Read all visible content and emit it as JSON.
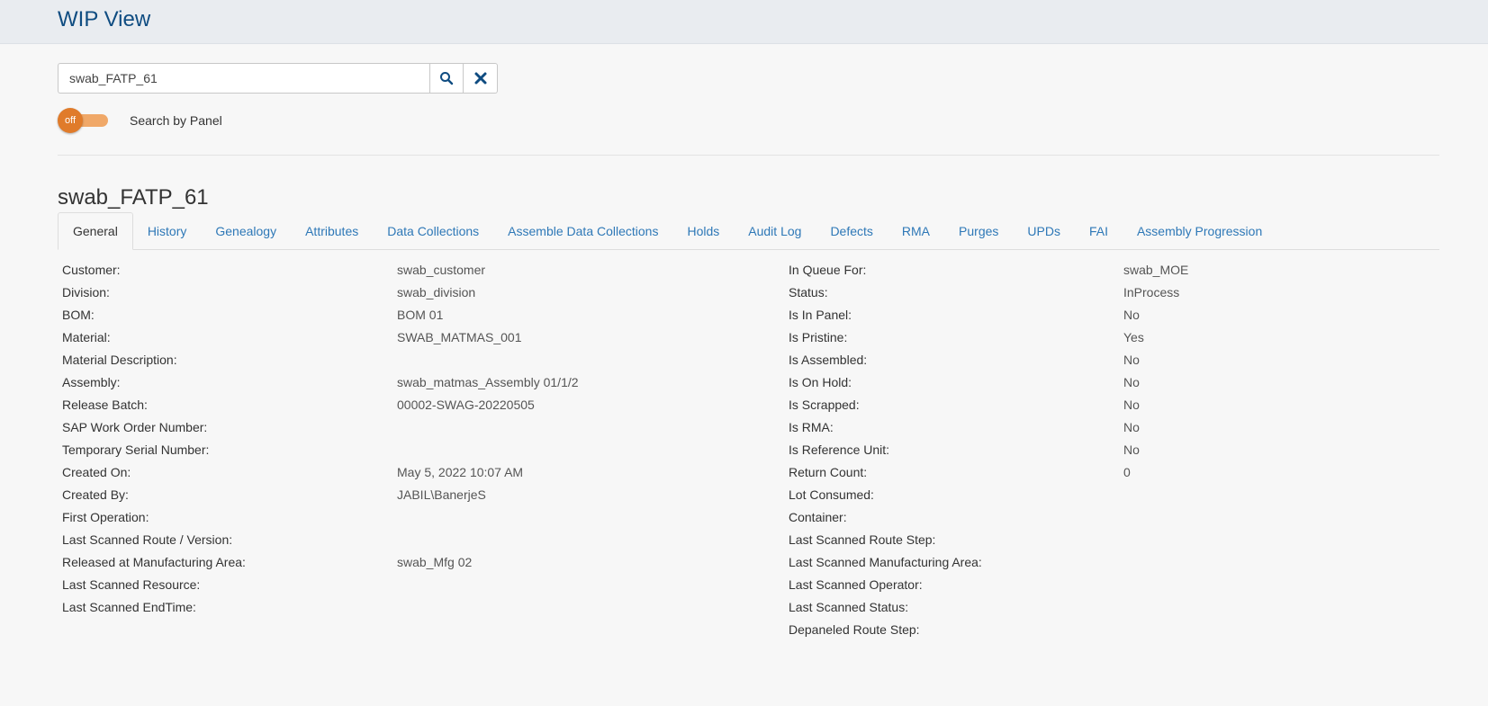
{
  "header": {
    "title": "WIP View"
  },
  "search": {
    "value": "swab_FATP_61"
  },
  "toggle": {
    "state_label": "off",
    "label": "Search by Panel"
  },
  "unit": {
    "title": "swab_FATP_61"
  },
  "tabs": [
    {
      "label": "General",
      "active": true
    },
    {
      "label": "History"
    },
    {
      "label": "Genealogy"
    },
    {
      "label": "Attributes"
    },
    {
      "label": "Data Collections"
    },
    {
      "label": "Assemble Data Collections"
    },
    {
      "label": "Holds"
    },
    {
      "label": "Audit Log"
    },
    {
      "label": "Defects"
    },
    {
      "label": "RMA"
    },
    {
      "label": "Purges"
    },
    {
      "label": "UPDs"
    },
    {
      "label": "FAI"
    },
    {
      "label": "Assembly Progression"
    }
  ],
  "left": [
    {
      "label": "Customer:",
      "value": "swab_customer"
    },
    {
      "label": "Division:",
      "value": "swab_division"
    },
    {
      "label": "BOM:",
      "value": "BOM 01"
    },
    {
      "label": "Material:",
      "value": "SWAB_MATMAS_001"
    },
    {
      "label": "Material Description:",
      "value": ""
    },
    {
      "label": "Assembly:",
      "value": "swab_matmas_Assembly 01/1/2"
    },
    {
      "label": "Release Batch:",
      "value": "00002-SWAG-20220505"
    },
    {
      "label": "SAP Work Order Number:",
      "value": ""
    },
    {
      "label": "Temporary Serial Number:",
      "value": ""
    },
    {
      "label": "Created On:",
      "value": "May 5, 2022 10:07 AM"
    },
    {
      "label": "Created By:",
      "value": "JABIL\\BanerjeS"
    },
    {
      "label": "First Operation:",
      "value": ""
    },
    {
      "label": "Last Scanned Route / Version:",
      "value": ""
    },
    {
      "label": "Released at Manufacturing Area:",
      "value": "swab_Mfg 02"
    },
    {
      "label": "Last Scanned Resource:",
      "value": ""
    },
    {
      "label": "Last Scanned EndTime:",
      "value": ""
    }
  ],
  "right": [
    {
      "label": "In Queue For:",
      "value": "swab_MOE"
    },
    {
      "label": "Status:",
      "value": "InProcess"
    },
    {
      "label": "Is In Panel:",
      "value": "No"
    },
    {
      "label": "Is Pristine:",
      "value": "Yes"
    },
    {
      "label": "Is Assembled:",
      "value": "No"
    },
    {
      "label": "Is On Hold:",
      "value": "No"
    },
    {
      "label": "Is Scrapped:",
      "value": "No"
    },
    {
      "label": "Is RMA:",
      "value": "No"
    },
    {
      "label": "Is Reference Unit:",
      "value": "No"
    },
    {
      "label": "Return Count:",
      "value": "0"
    },
    {
      "label": "Lot Consumed:",
      "value": ""
    },
    {
      "label": "Container:",
      "value": ""
    },
    {
      "label": "Last Scanned Route Step:",
      "value": ""
    },
    {
      "label": "Last Scanned Manufacturing Area:",
      "value": ""
    },
    {
      "label": "Last Scanned Operator:",
      "value": ""
    },
    {
      "label": "Last Scanned Status:",
      "value": ""
    },
    {
      "label": "Depaneled Route Step:",
      "value": ""
    }
  ]
}
